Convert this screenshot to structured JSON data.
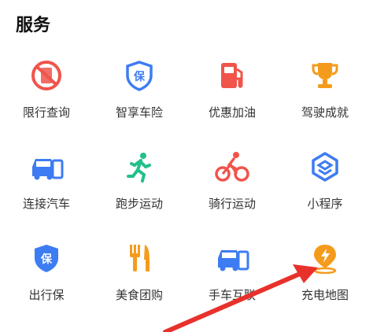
{
  "section": {
    "title": "服务"
  },
  "items": [
    {
      "label": "限行查询",
      "icon": "no-parking-icon",
      "color": "#f0544b"
    },
    {
      "label": "智享车险",
      "icon": "shield-insurance-icon",
      "color": "#3d7cf2"
    },
    {
      "label": "优惠加油",
      "icon": "fuel-pump-icon",
      "color": "#f0544b"
    },
    {
      "label": "驾驶成就",
      "icon": "trophy-icon",
      "color": "#f59b1c"
    },
    {
      "label": "连接汽车",
      "icon": "car-phone-icon",
      "color": "#3d7cf2"
    },
    {
      "label": "跑步运动",
      "icon": "runner-icon",
      "color": "#22c08a"
    },
    {
      "label": "骑行运动",
      "icon": "cyclist-icon",
      "color": "#f0544b"
    },
    {
      "label": "小程序",
      "icon": "mini-program-icon",
      "color": "#3d7cf2"
    },
    {
      "label": "出行保",
      "icon": "shield-travel-icon",
      "color": "#3d7cf2"
    },
    {
      "label": "美食团购",
      "icon": "fork-knife-icon",
      "color": "#f59b1c"
    },
    {
      "label": "手车互联",
      "icon": "car-phone-link-icon",
      "color": "#3d7cf2"
    },
    {
      "label": "充电地图",
      "icon": "charging-map-icon",
      "color": "#f59b1c"
    }
  ],
  "annotation": {
    "arrow_color": "#e8312b"
  }
}
